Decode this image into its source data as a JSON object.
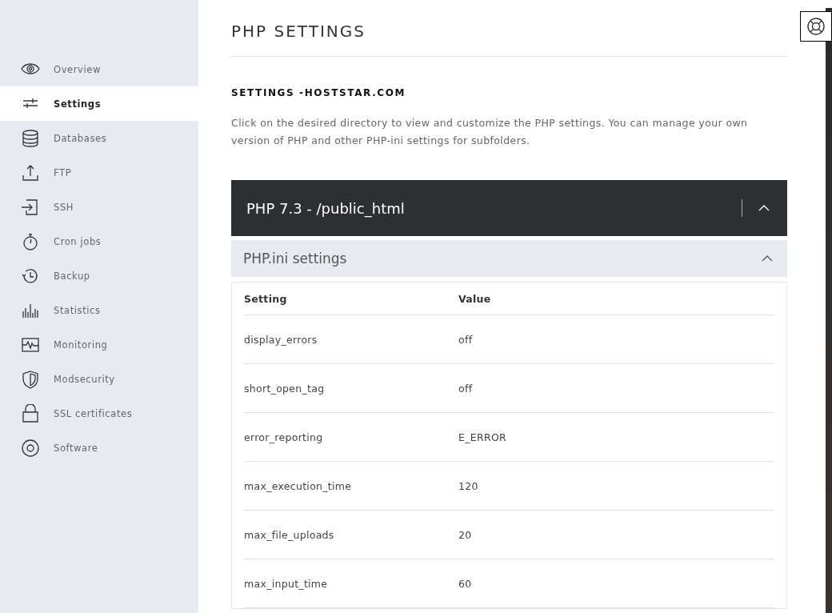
{
  "sidebar": {
    "items": [
      {
        "label": "Overview",
        "selected": false
      },
      {
        "label": "Settings",
        "selected": true
      },
      {
        "label": "Databases",
        "selected": false
      },
      {
        "label": "FTP",
        "selected": false
      },
      {
        "label": "SSH",
        "selected": false
      },
      {
        "label": "Cron jobs",
        "selected": false
      },
      {
        "label": "Backup",
        "selected": false
      },
      {
        "label": "Statistics",
        "selected": false
      },
      {
        "label": "Monitoring",
        "selected": false
      },
      {
        "label": "Modsecurity",
        "selected": false
      },
      {
        "label": "SSL certificates",
        "selected": false
      },
      {
        "label": "Software",
        "selected": false
      }
    ]
  },
  "page": {
    "title": "PHP SETTINGS",
    "subtitle": "SETTINGS -HOSTSTAR.COM",
    "description": "Click on the desired directory to view and customize the PHP settings. You can manage your own version of PHP and other PHP-ini settings for subfolders."
  },
  "directory_panel": {
    "title": "PHP 7.3 - /public_html",
    "expanded": true
  },
  "ini_panel": {
    "title": "PHP.ini settings",
    "expanded": true
  },
  "table": {
    "columns": [
      "Setting",
      "Value"
    ],
    "rows": [
      [
        "display_errors",
        "off"
      ],
      [
        "short_open_tag",
        "off"
      ],
      [
        "error_reporting",
        "E_ERROR"
      ],
      [
        "max_execution_time",
        "120"
      ],
      [
        "max_file_uploads",
        "20"
      ],
      [
        "max_input_time",
        "60"
      ]
    ]
  }
}
